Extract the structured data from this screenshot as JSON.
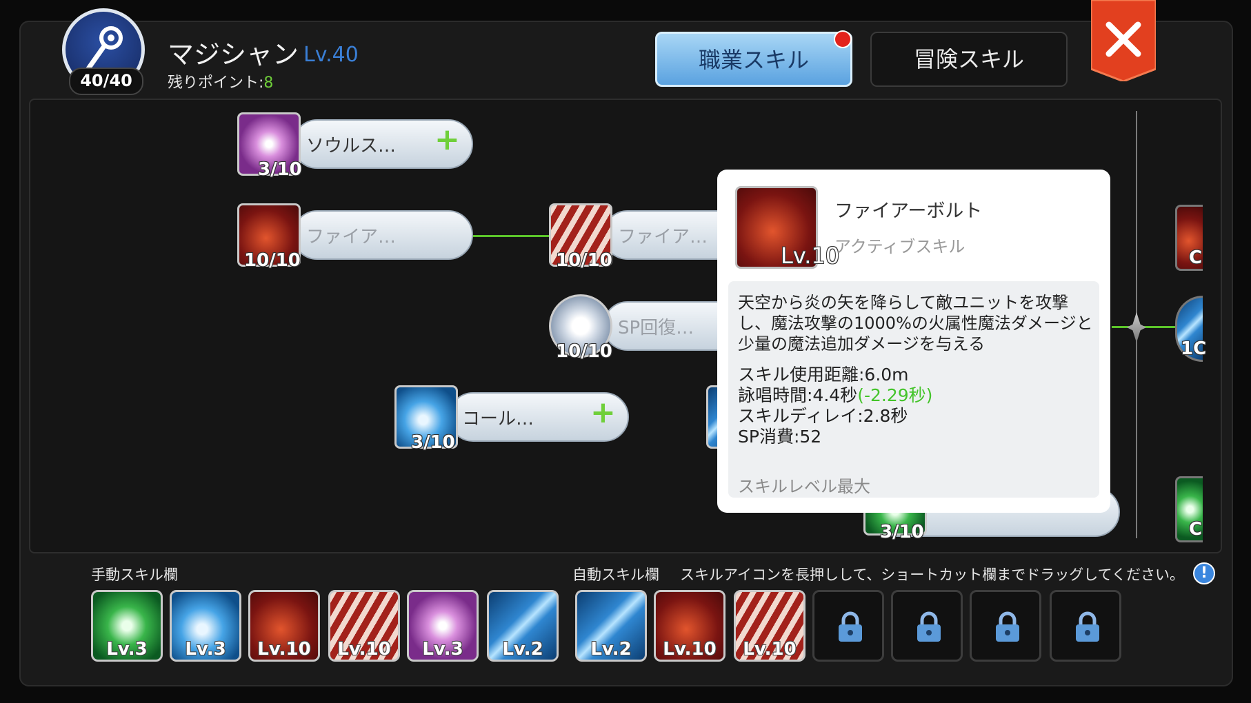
{
  "header": {
    "class_name": "マジシャン",
    "class_level": "Lv.40",
    "remaining_points_label": "残りポイント:",
    "remaining_points_value": "8",
    "badge_value": "40/40",
    "tab_job_skill": "職業スキル",
    "tab_adventure_skill": "冒険スキル"
  },
  "tree": {
    "nodes": [
      {
        "label": "ソウルス…",
        "level": "3/10",
        "color": "purple"
      },
      {
        "label": "ファイア…",
        "level": "10/10",
        "color": "red"
      },
      {
        "label": "ファイア…",
        "level": "10/10",
        "color": "red"
      },
      {
        "label": "SP回復…",
        "level": "10/10",
        "color": "silver"
      },
      {
        "label": "コール…",
        "level": "3/10",
        "color": "blue"
      }
    ],
    "partial_level": "3/10",
    "edge_levels": [
      "C",
      "1C",
      "C"
    ]
  },
  "tooltip": {
    "name": "ファイアーボルト",
    "type": "アクティブスキル",
    "level": "Lv.10",
    "description": "天空から炎の矢を降らして敵ユニットを攻撃し、魔法攻撃の1000%の火属性魔法ダメージと少量の魔法追加ダメージを与える",
    "range": "スキル使用距離:6.0m",
    "cast_time": "詠唱時間:4.4秒",
    "cast_bonus": "(-2.29秒)",
    "delay": "スキルディレイ:2.8秒",
    "sp_cost": "SP消費:52",
    "max_note": "スキルレベル最大"
  },
  "bottom": {
    "manual_label": "手動スキル欄",
    "auto_label": "自動スキル欄",
    "hint": "スキルアイコンを長押しして、ショートカット欄までドラッグしてください。",
    "info_icon": "!",
    "manual_slots": [
      "Lv.3",
      "Lv.3",
      "Lv.10",
      "Lv.10",
      "Lv.3",
      "Lv.2"
    ],
    "auto_slots": [
      "Lv.2",
      "Lv.10",
      "Lv.10"
    ]
  },
  "colors": {
    "accent_green": "#6fcf3a",
    "level_blue": "#3a7fd6",
    "close_red": "#e2401f"
  }
}
